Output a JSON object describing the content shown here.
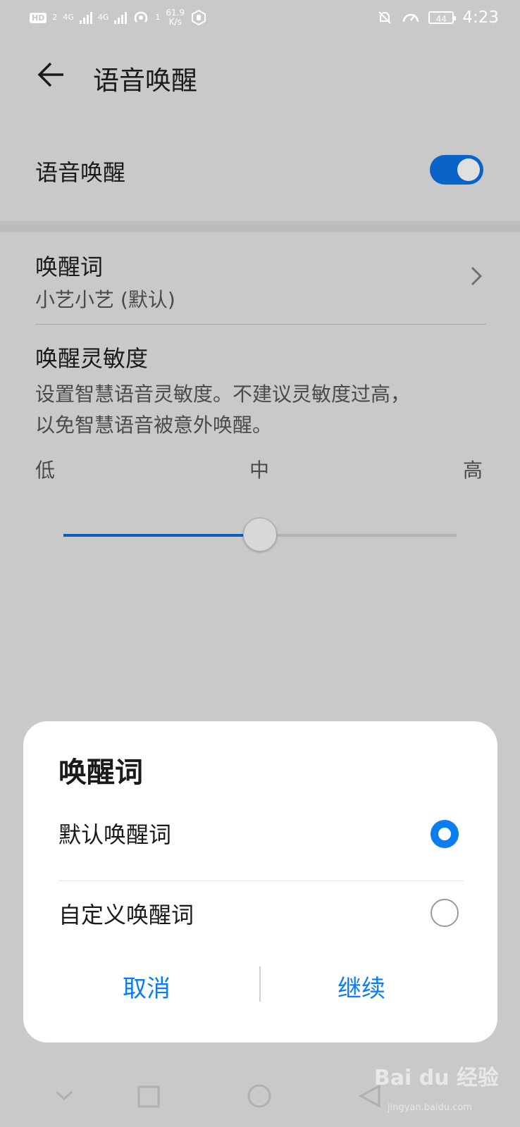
{
  "status_bar": {
    "hd": "HD",
    "hd_sub": "2",
    "sig1": "4G",
    "sig2": "4G",
    "wifi_sub": "1",
    "speed_value": "61.9",
    "speed_unit": "K/s",
    "battery": "44",
    "time": "4:23"
  },
  "header": {
    "title": "语音唤醒"
  },
  "voice_wake": {
    "label": "语音唤醒",
    "enabled": true
  },
  "wake_word": {
    "label": "唤醒词",
    "value": "小艺小艺 (默认)"
  },
  "sensitivity": {
    "label": "唤醒灵敏度",
    "desc_line1": "设置智慧语音灵敏度。不建议灵敏度过高，",
    "desc_line2": "以免智慧语音被意外唤醒。",
    "low": "低",
    "mid": "中",
    "high": "高",
    "level": 0.5
  },
  "dialog": {
    "title": "唤醒词",
    "options": [
      {
        "label": "默认唤醒词",
        "selected": true
      },
      {
        "label": "自定义唤醒词",
        "selected": false
      }
    ],
    "cancel": "取消",
    "continue": "继续"
  },
  "watermark": {
    "brand": "Bai du 经验",
    "url": "jingyan.baidu.com"
  },
  "colors": {
    "accent": "#0a7df0",
    "toggle": "#0a64c8",
    "overlay": "#c9c9c9"
  }
}
